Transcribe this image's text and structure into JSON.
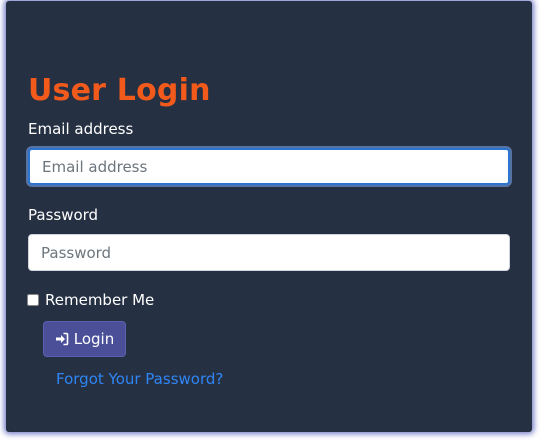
{
  "form": {
    "title": "User Login",
    "email_label": "Email address",
    "email_placeholder": "Email address",
    "email_value": "",
    "password_label": "Password",
    "password_placeholder": "Password",
    "password_value": "",
    "remember_label": "Remember Me",
    "remember_checked": false,
    "login_label": "Login",
    "login_icon": "sign-in-icon",
    "forgot_label": "Forgot Your Password?"
  },
  "colors": {
    "panel_background": "#263043",
    "title": "#f25a1c",
    "button": "#4a4f98",
    "link": "#2e86f5"
  }
}
